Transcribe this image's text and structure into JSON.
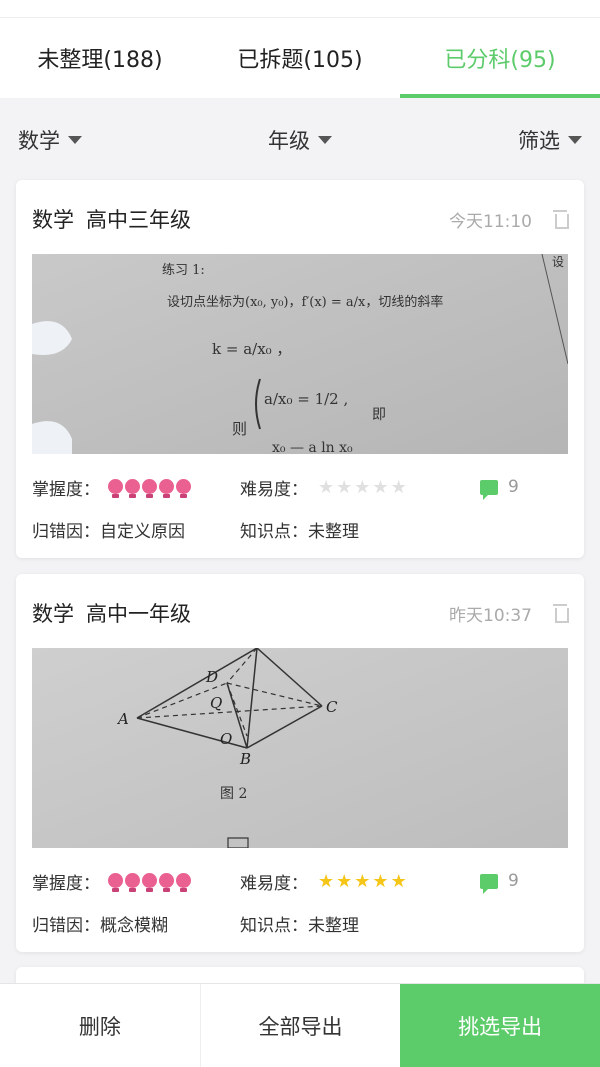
{
  "tabs": [
    {
      "label": "未整理(188)"
    },
    {
      "label": "已拆题(105)"
    },
    {
      "label": "已分科(95)"
    }
  ],
  "filters": {
    "subject": "数学",
    "grade": "年级",
    "filter": "筛选"
  },
  "labels": {
    "mastery": "掌握度：",
    "difficulty": "难易度：",
    "error_cause": "归错因：",
    "knowledge": "知识点："
  },
  "cards": [
    {
      "subject": "数学",
      "grade": "高中三年级",
      "time": "今天11:10",
      "mastery": 5,
      "difficulty": 0,
      "comments": "9",
      "error_cause": "自定义原因",
      "knowledge": "未整理",
      "photo_text": {
        "l1": "练习 1:",
        "l2": "设切点坐标为(x₀, y₀)，f′(x) = a/x，切线的斜率",
        "l3": "k = a/x₀ ，",
        "l4": "a/x₀ = 1/2 ,",
        "l5": "即",
        "l6": "则",
        "l7": "x₀ — a ln x₀",
        "corner": "设"
      }
    },
    {
      "subject": "数学",
      "grade": "高中一年级",
      "time": "昨天10:37",
      "mastery": 5,
      "difficulty": 5,
      "comments": "9",
      "error_cause": "概念模糊",
      "knowledge": "未整理",
      "photo_text": {
        "A": "A",
        "B": "B",
        "C": "C",
        "D": "D",
        "Q": "Q",
        "O": "O",
        "caption": "图 2"
      }
    }
  ],
  "bottom": {
    "delete": "删除",
    "export_all": "全部导出",
    "export_selected": "挑选导出"
  },
  "colors": {
    "accent": "#5ccb6a",
    "bulb": "#ea6090",
    "star_on": "#f5c518",
    "star_off": "#e0e0e0"
  }
}
